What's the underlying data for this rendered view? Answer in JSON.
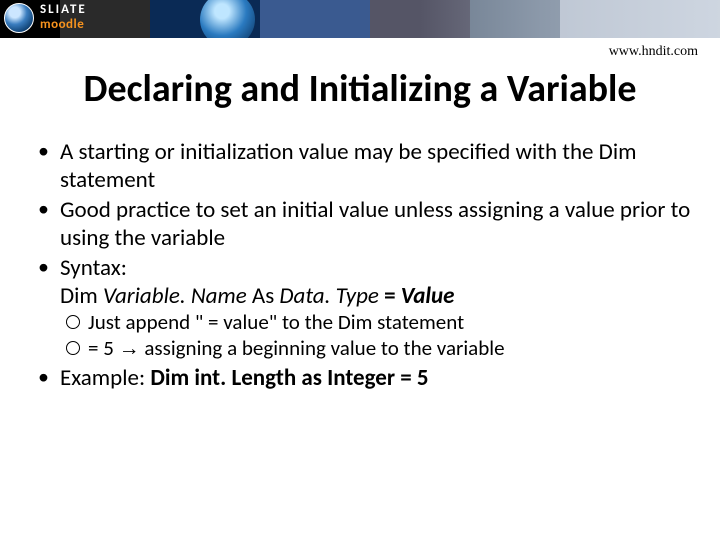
{
  "banner": {
    "logo_line1": "SLIATE",
    "logo_line2": "moodle"
  },
  "header": {
    "url": "www.hndit.com",
    "title": "Declaring and Initializing a Variable"
  },
  "bullets": {
    "b1": "A starting or initialization value may be specified with the Dim statement",
    "b2": "Good practice to set an initial value unless assigning a value prior to using the variable",
    "b3_label": "Syntax:",
    "b3_syntax_dim": "Dim ",
    "b3_syntax_var": "Variable. Name ",
    "b3_syntax_as": "As ",
    "b3_syntax_type": "Data. Type ",
    "b3_syntax_eq": "= ",
    "b3_syntax_val": "Value",
    "sub1": "Just append \" = value\" to the Dim statement",
    "sub2_pre": "= 5 ",
    "sub2_arrow": "→",
    "sub2_post": " assigning a beginning value to the variable",
    "b4_label": "Example:   ",
    "b4_code": "Dim int. Length as Integer = 5"
  }
}
